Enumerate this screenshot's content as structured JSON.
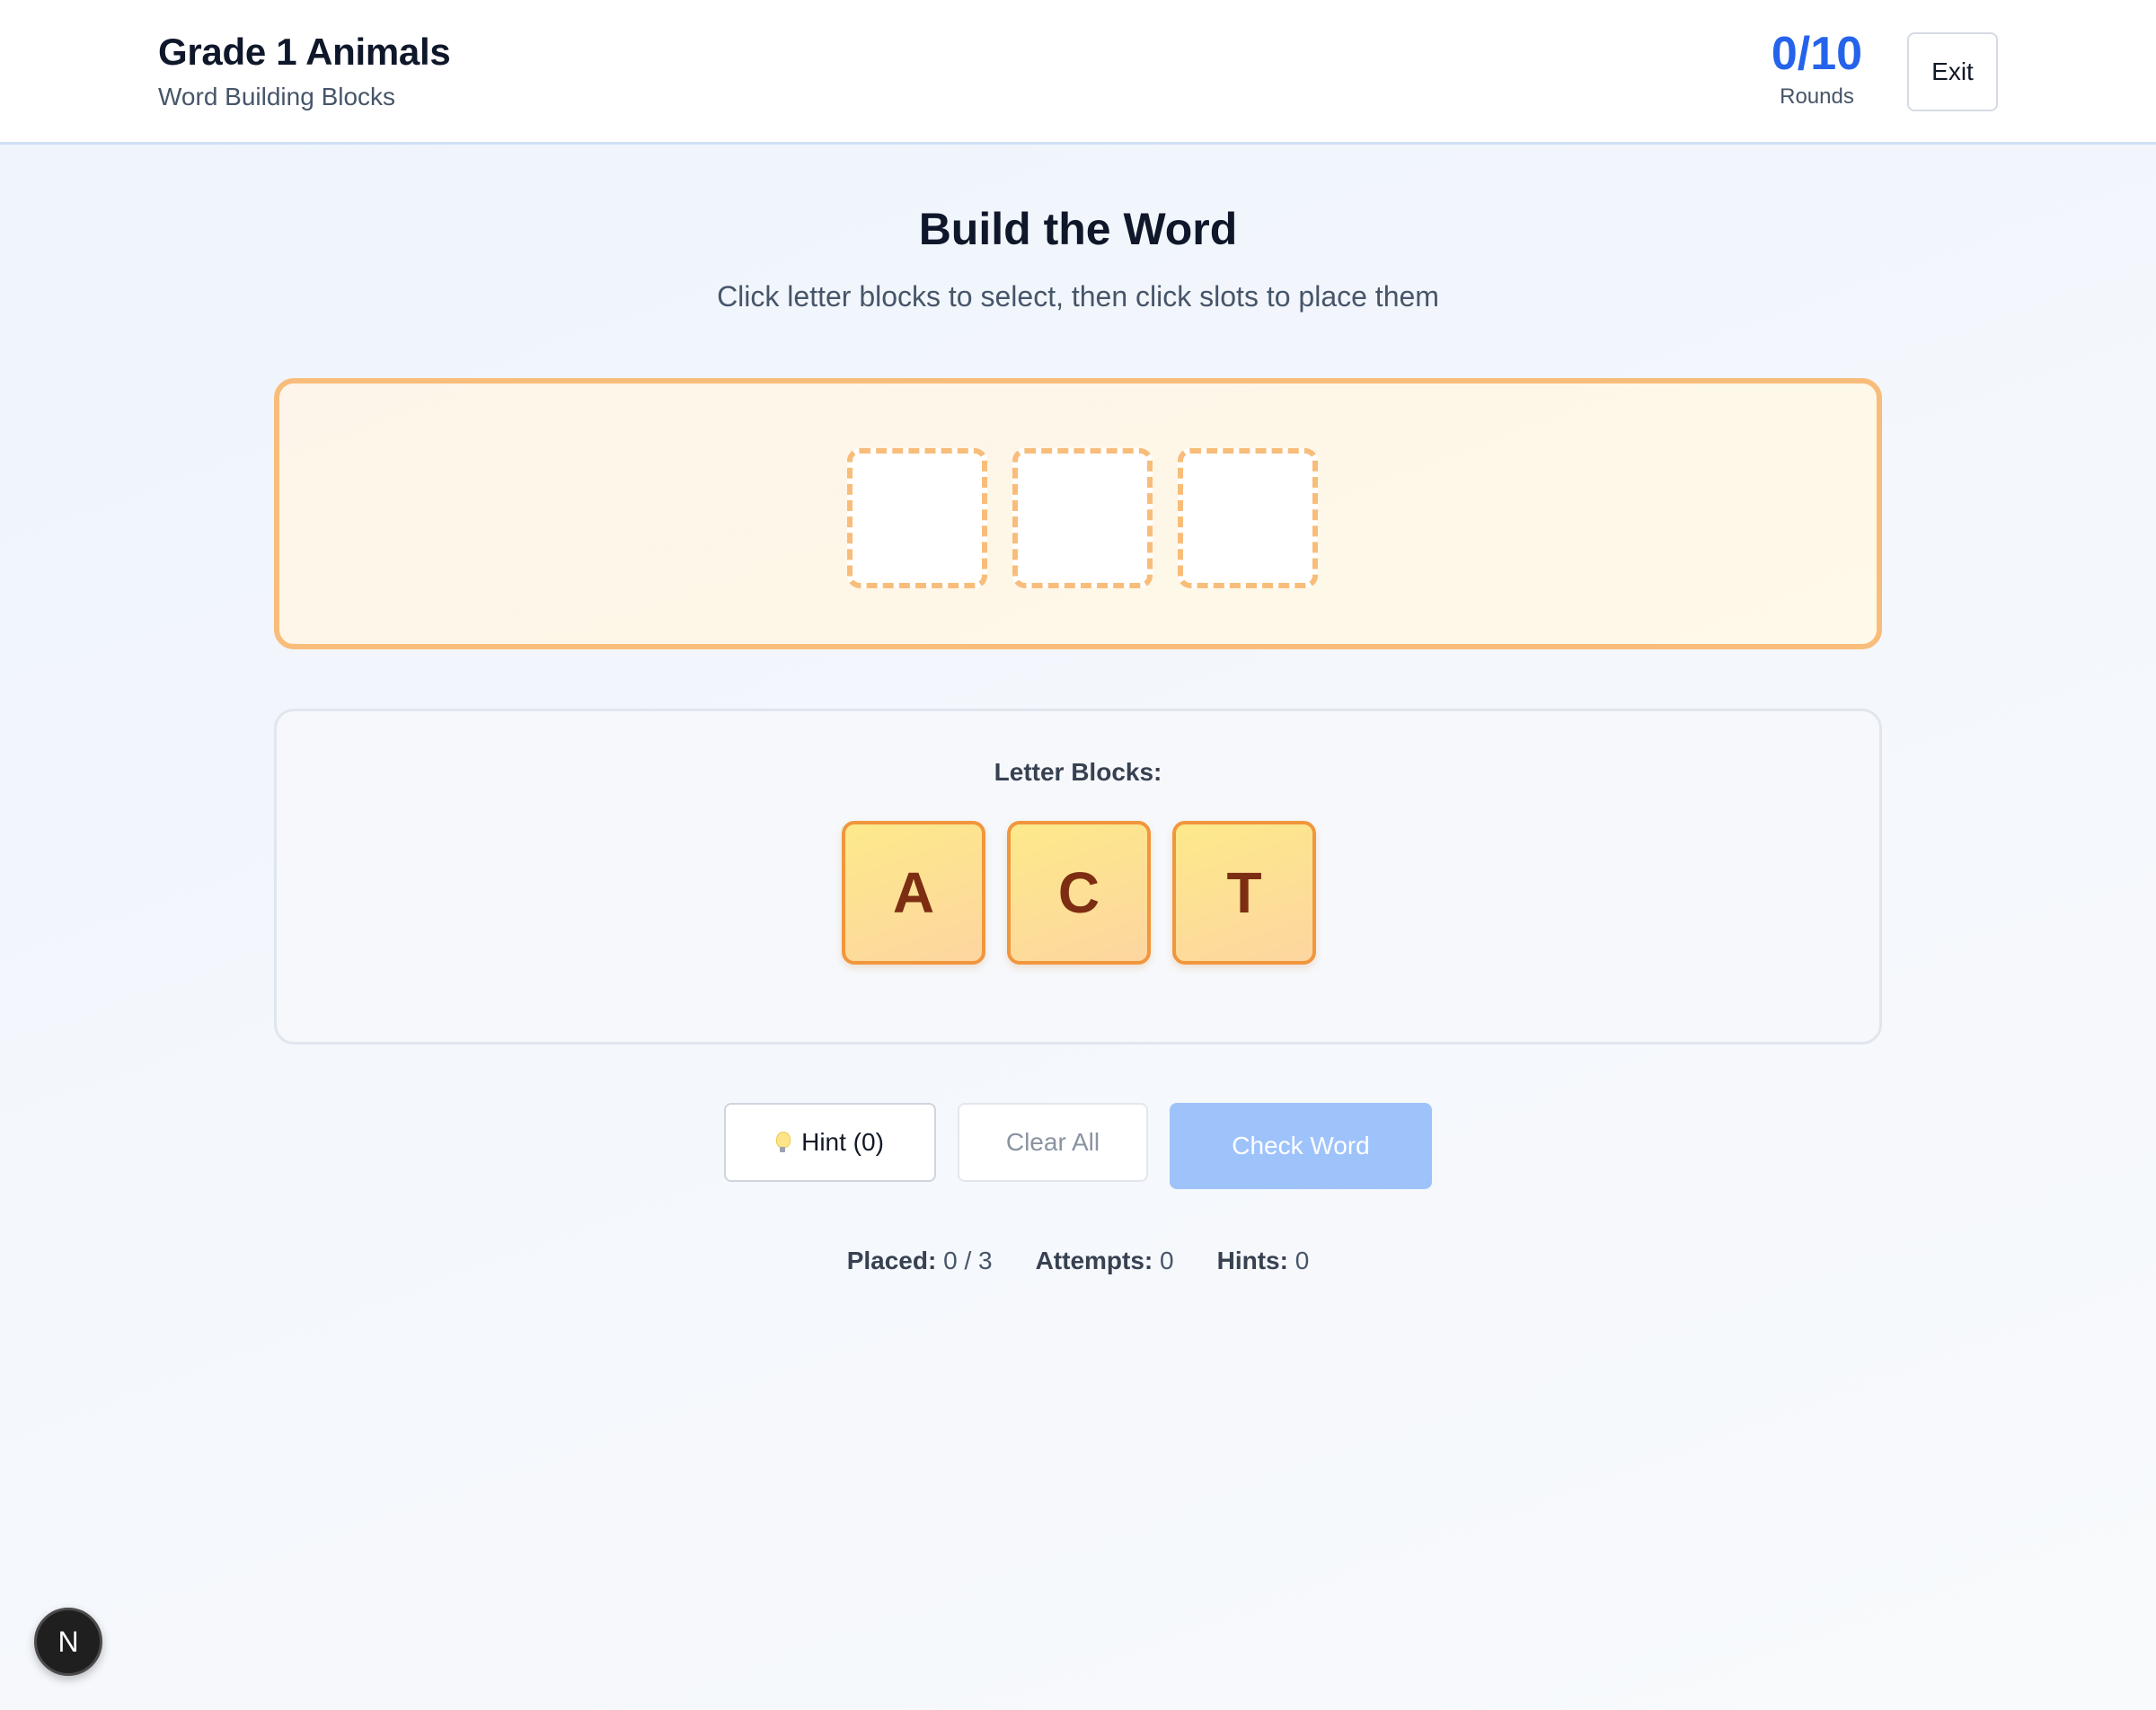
{
  "header": {
    "title": "Grade 1 Animals",
    "subtitle": "Word Building Blocks",
    "score_value": "0/10",
    "score_label": "Rounds",
    "exit_label": "Exit"
  },
  "main": {
    "title": "Build the Word",
    "instructions": "Click letter blocks to select, then click slots to place them",
    "slots": [
      "",
      "",
      ""
    ],
    "blocks_label": "Letter Blocks:",
    "blocks": [
      "A",
      "C",
      "T"
    ]
  },
  "actions": {
    "hint_label": "Hint (0)",
    "clear_label": "Clear All",
    "check_label": "Check Word"
  },
  "stats": {
    "placed_label": "Placed:",
    "placed_value": "0 / 3",
    "attempts_label": "Attempts:",
    "attempts_value": "0",
    "hints_label": "Hints:",
    "hints_value": "0"
  },
  "badge": {
    "letter": "N"
  },
  "icons": {
    "hint": "lightbulb-icon"
  },
  "colors": {
    "accent": "#2563eb",
    "slot_border": "#f8bd7a",
    "block_border": "#f1963d",
    "block_text": "#7c2d12",
    "check_button": "#9ec3fb"
  }
}
